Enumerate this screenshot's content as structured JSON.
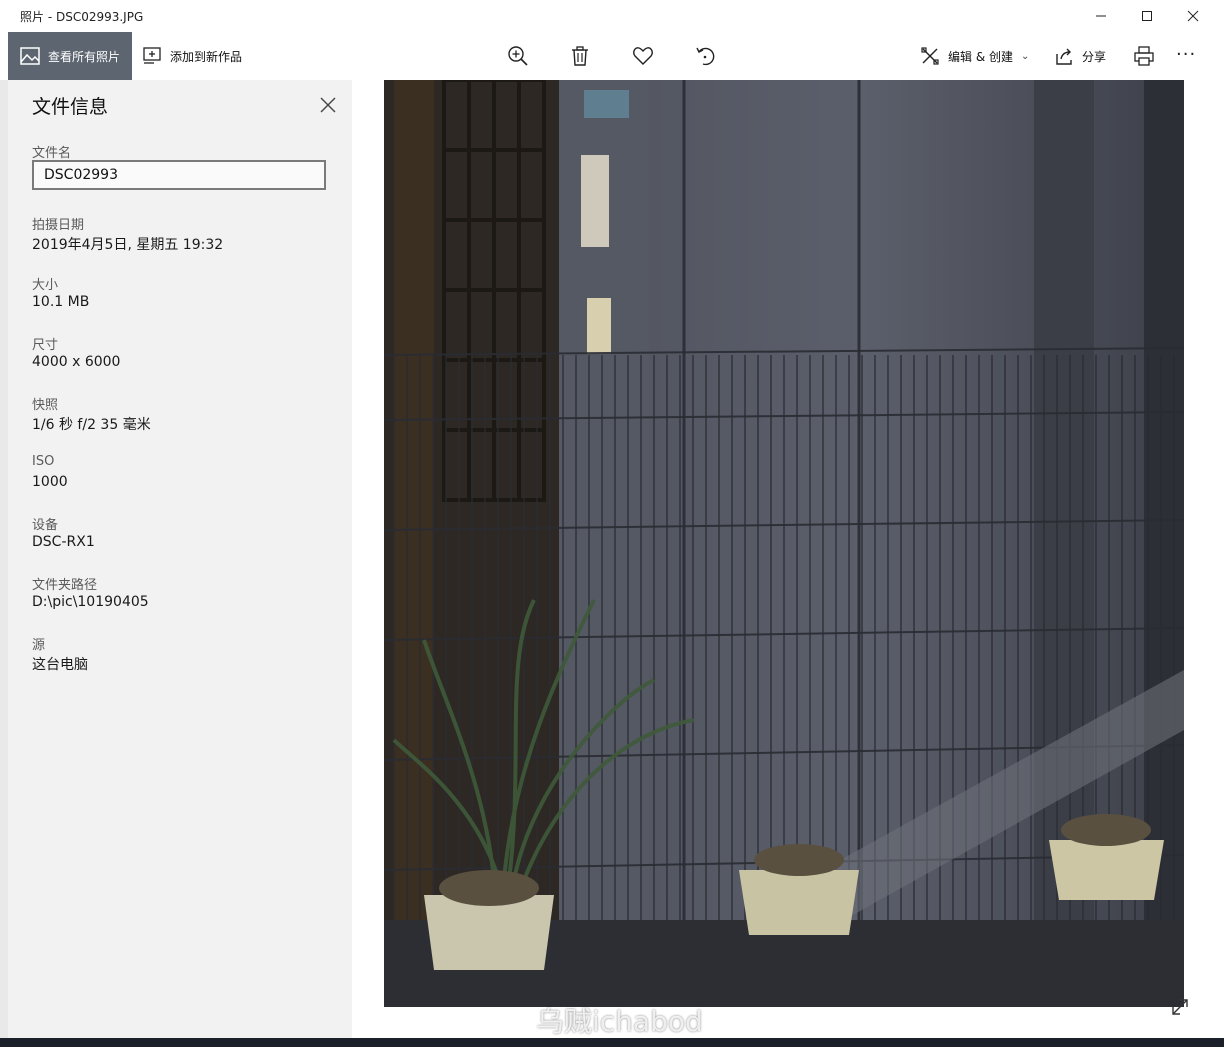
{
  "window": {
    "title": "照片 - DSC02993.JPG"
  },
  "toolbar": {
    "view_all_label": "查看所有照片",
    "add_to_creation_label": "添加到新作品",
    "edit_create_label": "编辑 & 创建",
    "share_label": "分享",
    "icons": [
      "zoom-in-icon",
      "delete-icon",
      "heart-icon",
      "rotate-icon",
      "edit-create-icon",
      "share-icon",
      "print-icon",
      "more-icon"
    ]
  },
  "file_info": {
    "title": "文件信息",
    "filename_label": "文件名",
    "filename_value": "DSC02993",
    "date_label": "拍摄日期",
    "date_value": "2019年4月5日, 星期五 19:32",
    "size_label": "大小",
    "size_value": "10.1 MB",
    "dimensions_label": "尺寸",
    "dimensions_value": "4000 x 6000",
    "shutter_label": "快照",
    "shutter_value": "1/6 秒 f/2 35 毫米",
    "iso_label": "ISO",
    "iso_value": "1000",
    "device_label": "设备",
    "device_value": "DSC-RX1",
    "folder_label": "文件夹路径",
    "folder_value": "D:\\pic\\10190405",
    "source_label": "源",
    "source_value": "这台电脑"
  },
  "watermark": {
    "text": "乌贼ichabod"
  },
  "colors": {
    "accent_button": "#5d6670",
    "panel_bg": "#f2f2f2"
  }
}
